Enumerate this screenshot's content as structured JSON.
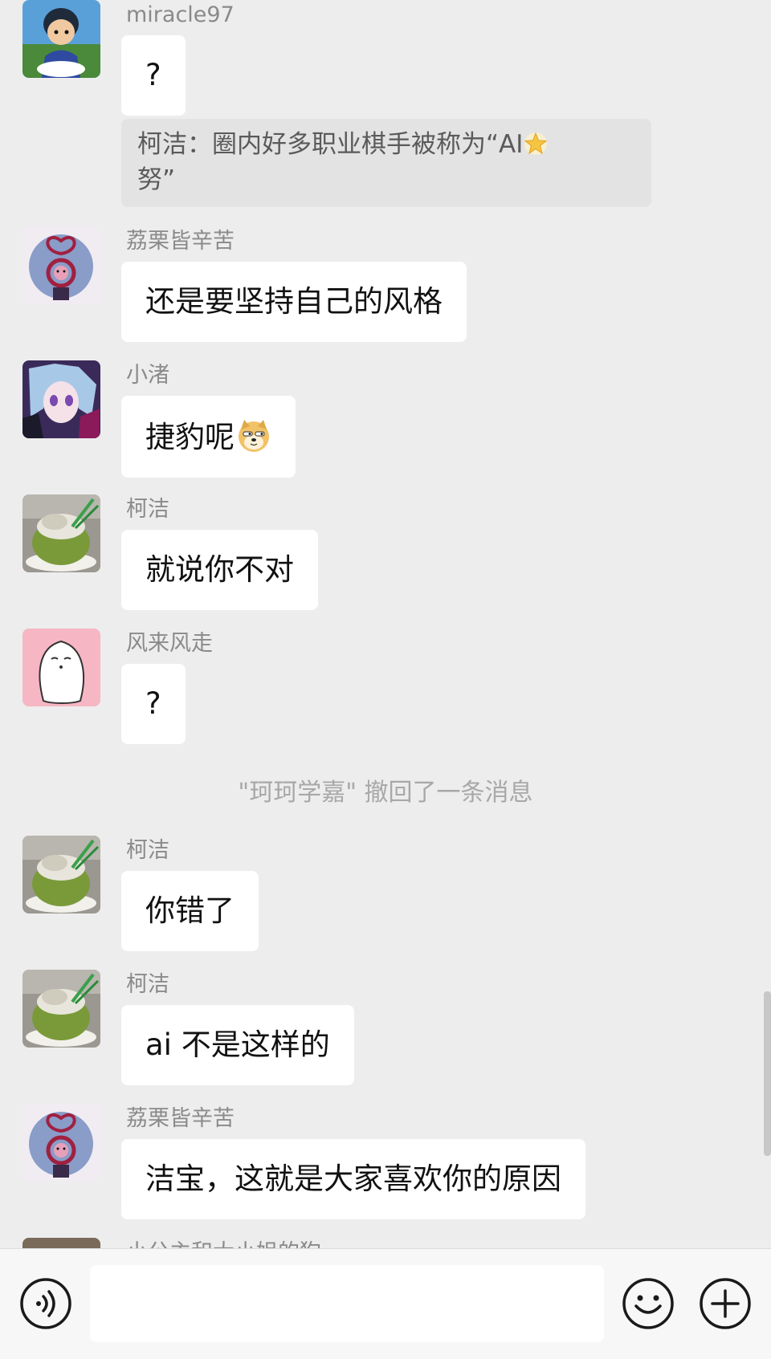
{
  "messages": [
    {
      "sender": "miracle97",
      "text": "?",
      "avatar": "boy-cartoon-avatar",
      "quote": {
        "prefix": "柯洁：圈内好多职业棋手被称为“AI",
        "suffix": "努”"
      }
    },
    {
      "sender": "荔栗皆辛苦",
      "text": "还是要坚持自己的风格",
      "avatar": "figure-eight-avatar"
    },
    {
      "sender": "小渚",
      "text": "捷豹呢",
      "avatar": "anime-girl-avatar"
    },
    {
      "sender": "柯洁",
      "text": "就说你不对",
      "avatar": "coconut-avatar"
    },
    {
      "sender": "风来风走",
      "text": "?",
      "avatar": "white-blob-avatar"
    },
    {
      "sender": "柯洁",
      "text": "你错了",
      "avatar": "coconut-avatar"
    },
    {
      "sender": "柯洁",
      "text": "ai 不是这样的",
      "avatar": "coconut-avatar"
    },
    {
      "sender": "荔栗皆辛苦",
      "text": "洁宝，这就是大家喜欢你的原因",
      "avatar": "figure-eight-avatar"
    },
    {
      "sender": "小公主和大小姐的狗",
      "avatar": "partial-avatar"
    }
  ],
  "system_notice": "\"珂珂学嘉\" 撤回了一条消息",
  "input": {
    "value": "",
    "placeholder": ""
  },
  "icons": {
    "voice": "voice-icon",
    "emoji": "emoji-icon",
    "plus": "plus-icon",
    "star_sticker": "star-emoji-icon",
    "doge_sticker": "doge-emoji-icon"
  },
  "colors": {
    "background": "#ededed",
    "bubble": "#ffffff",
    "quote": "#e3e3e3",
    "name": "#8a8a8a",
    "system": "#a8a8a8"
  }
}
